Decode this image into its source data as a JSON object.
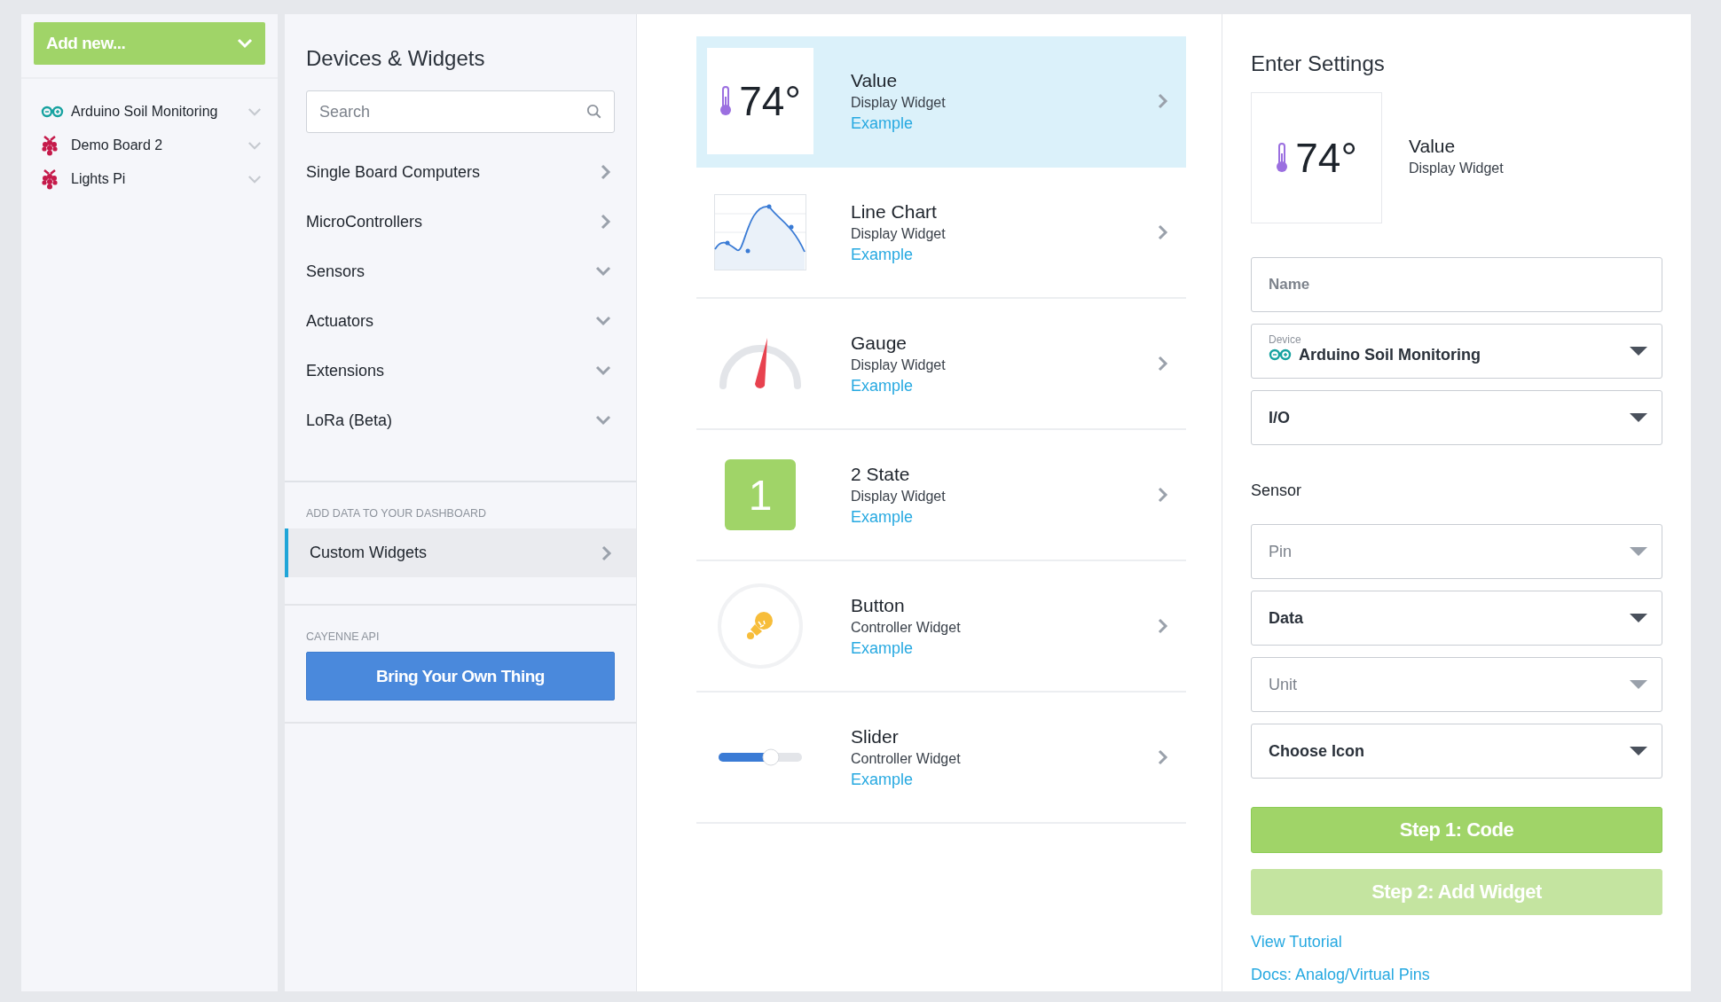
{
  "sidebar": {
    "add_button": "Add new...",
    "devices": [
      {
        "name": "Arduino Soil Monitoring",
        "kind": "arduino"
      },
      {
        "name": "Demo Board 2",
        "kind": "raspberry"
      },
      {
        "name": "Lights Pi",
        "kind": "raspberry"
      }
    ]
  },
  "catalog": {
    "title": "Devices & Widgets",
    "search": {
      "placeholder": "Search"
    },
    "categories": [
      {
        "label": "Single Board Computers",
        "kind": "link"
      },
      {
        "label": "MicroControllers",
        "kind": "link"
      },
      {
        "label": "Sensors",
        "kind": "group"
      },
      {
        "label": "Actuators",
        "kind": "group"
      },
      {
        "label": "Extensions",
        "kind": "group"
      },
      {
        "label": "LoRa (Beta)",
        "kind": "group"
      }
    ],
    "dashboard_heading": "ADD DATA TO YOUR DASHBOARD",
    "custom_widgets": {
      "label": "Custom Widgets",
      "selected": true
    },
    "api_heading": "CAYENNE API",
    "api_button": "Bring Your Own Thing"
  },
  "widgets": [
    {
      "kind": "value",
      "preview": "74°",
      "name": "Value",
      "type": "Display Widget",
      "link": "Example",
      "selected": true
    },
    {
      "kind": "line",
      "name": "Line Chart",
      "type": "Display Widget",
      "link": "Example",
      "selected": false
    },
    {
      "kind": "gauge",
      "name": "Gauge",
      "type": "Display Widget",
      "link": "Example",
      "selected": false
    },
    {
      "kind": "state",
      "preview": "1",
      "name": "2 State",
      "type": "Display Widget",
      "link": "Example",
      "selected": false
    },
    {
      "kind": "button",
      "name": "Button",
      "type": "Controller Widget",
      "link": "Example",
      "selected": false
    },
    {
      "kind": "slider",
      "name": "Slider",
      "type": "Controller Widget",
      "link": "Example",
      "selected": false
    }
  ],
  "settings": {
    "title": "Enter Settings",
    "preview": {
      "value": "74°",
      "name": "Value",
      "type": "Display Widget"
    },
    "fields": [
      {
        "kind": "input",
        "placeholder": "Name"
      },
      {
        "kind": "device",
        "label": "Device",
        "value": "Arduino Soil Monitoring"
      },
      {
        "kind": "select",
        "value": "I/O"
      },
      {
        "kind": "heading",
        "text": "Sensor"
      },
      {
        "kind": "select",
        "placeholder": "Pin"
      },
      {
        "kind": "select",
        "value": "Data"
      },
      {
        "kind": "select",
        "placeholder": "Unit"
      },
      {
        "kind": "select",
        "value": "Choose Icon"
      }
    ],
    "buttons": [
      {
        "label": "Step 1: Code",
        "disabled": false
      },
      {
        "label": "Step 2: Add Widget",
        "disabled": true
      }
    ],
    "links": [
      "View Tutorial",
      "Docs: Analog/Virtual Pins"
    ]
  }
}
